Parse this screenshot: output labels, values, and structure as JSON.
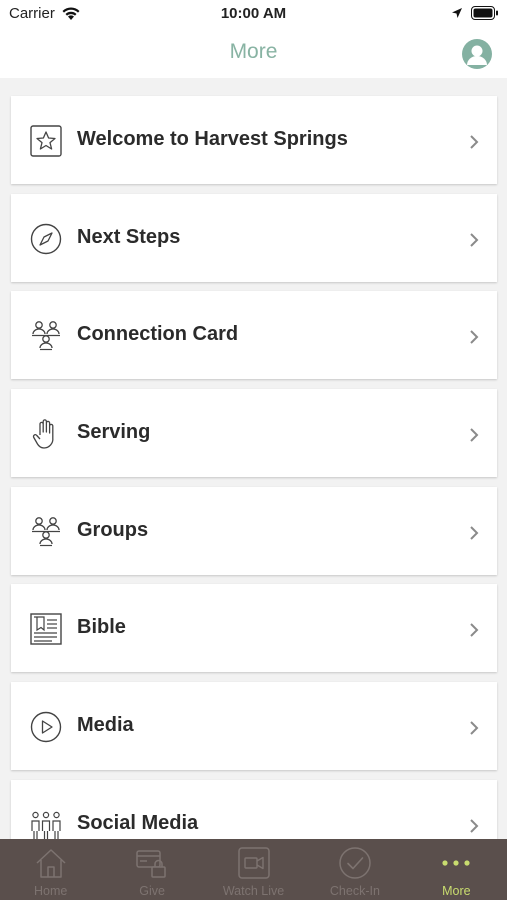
{
  "status_bar": {
    "carrier": "Carrier",
    "time": "10:00 AM"
  },
  "header": {
    "title": "More",
    "profile_icon": "user-profile-icon",
    "accent_color": "#88b3a3"
  },
  "menu": {
    "items": [
      {
        "label": "Welcome to Harvest Springs",
        "icon": "star-icon"
      },
      {
        "label": "Next Steps",
        "icon": "compass-icon"
      },
      {
        "label": "Connection Card",
        "icon": "people-group-icon"
      },
      {
        "label": "Serving",
        "icon": "hand-icon"
      },
      {
        "label": "Groups",
        "icon": "people-group-icon"
      },
      {
        "label": "Bible",
        "icon": "book-icon"
      },
      {
        "label": "Media",
        "icon": "play-icon"
      },
      {
        "label": "Social Media",
        "icon": "people-row-icon"
      }
    ]
  },
  "tab_bar": {
    "background": "#5a4f4c",
    "active_color": "#c9dd6f",
    "tabs": [
      {
        "label": "Home",
        "icon": "home-icon"
      },
      {
        "label": "Give",
        "icon": "wallet-lock-icon"
      },
      {
        "label": "Watch Live",
        "icon": "video-icon"
      },
      {
        "label": "Check-In",
        "icon": "check-circle-icon"
      },
      {
        "label": "More",
        "icon": "more-dots-icon",
        "active": true
      }
    ]
  }
}
